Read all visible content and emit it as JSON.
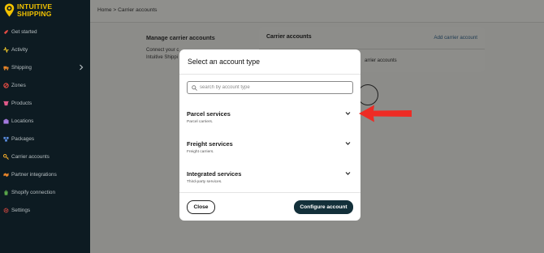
{
  "sidebar": {
    "logo": {
      "line1": "INTUITIVE",
      "line2": "SHIPPING"
    },
    "items": [
      {
        "label": "Get started",
        "icon": "rocket-icon",
        "icon_color": "#e04b43"
      },
      {
        "label": "Activity",
        "icon": "activity-icon",
        "icon_color": "#e8c12a"
      },
      {
        "label": "Shipping",
        "icon": "truck-icon",
        "icon_color": "#e8852a",
        "has_chevron": true
      },
      {
        "label": "Zones",
        "icon": "zone-icon",
        "icon_color": "#e04b43"
      },
      {
        "label": "Products",
        "icon": "products-icon",
        "icon_color": "#e05a8a"
      },
      {
        "label": "Locations",
        "icon": "location-icon",
        "icon_color": "#a57be0"
      },
      {
        "label": "Packages",
        "icon": "package-icon",
        "icon_color": "#5b8de0"
      },
      {
        "label": "Carrier accounts",
        "icon": "key-icon",
        "icon_color": "#e8a42a"
      },
      {
        "label": "Partner integrations",
        "icon": "partner-icon",
        "icon_color": "#e8852a"
      },
      {
        "label": "Shopify connection",
        "icon": "shopify-icon",
        "icon_color": "#5ba84a"
      },
      {
        "label": "Settings",
        "icon": "gear-icon",
        "icon_color": "#e04b43"
      }
    ]
  },
  "header": {
    "breadcrumb": "Home > Carrier accounts"
  },
  "background": {
    "manage_title": "Manage carrier accounts",
    "manage_desc_line1": "Connect your c",
    "manage_desc_line2": "Intuitive Shippi",
    "card_title": "Carrier accounts",
    "add_link": "Add carrier account",
    "card_text": "arrier accounts"
  },
  "modal": {
    "title": "Select an account type",
    "search_placeholder": "search by account type",
    "sections": [
      {
        "title": "Parcel services",
        "subtitle": "Parcel carriers."
      },
      {
        "title": "Freight services",
        "subtitle": "Freight carriers."
      },
      {
        "title": "Integrated services",
        "subtitle": "Third-party services."
      }
    ],
    "close_label": "Close",
    "configure_label": "Configure account"
  },
  "colors": {
    "accent_dark": "#13303a",
    "logo_yellow": "#f2c200",
    "arrow_red": "#ee2b24",
    "sidebar_bg": "#0d1b22"
  }
}
